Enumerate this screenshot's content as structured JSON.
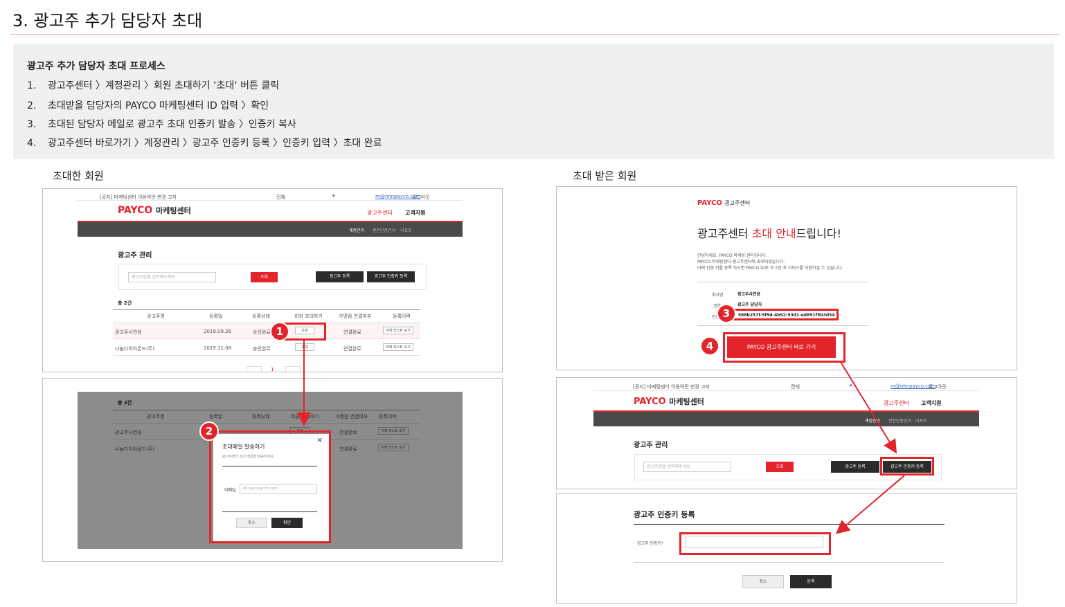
{
  "page_title": "3. 광고주 추가 담당자 초대",
  "process": {
    "heading": "광고주 추가 담당자 초대 프로세스",
    "steps": [
      {
        "num": "1.",
        "text": "광고주센터 〉계정관리 〉회원 초대하기 ‘초대‘ 버튼 클릭"
      },
      {
        "num": "2.",
        "text": "초대받을 담당자의 PAYCO 마케팅센터 ID 입력 〉확인"
      },
      {
        "num": "3.",
        "text": "초대된 담당자 메일로 광고주 초대 인증키 발송 〉인증키 복사"
      },
      {
        "num": "4.",
        "text": "광고주센터 바로가기 〉계정관리 〉광고주 인증키 등록 〉인증키 입력 〉초대 완료"
      }
    ]
  },
  "left": {
    "label": "초대한 회원",
    "notice": "[공지] 마케팅센터 이용약관 변경 고지",
    "notice_select": "전체",
    "user_email": "m@nhnpayco.com",
    "logout": "로그아웃",
    "logo_brand": "PAYCO",
    "logo_suffix": "마케팅센터",
    "nav_advertiser_center": "광고주센터",
    "nav_support": "고객지원",
    "subnav": [
      "계정관리",
      "권한인증관리",
      "리포트"
    ],
    "section_title": "광고주 관리",
    "search_placeholder": "광고주명을 입력해주세요",
    "search_btn": "조회",
    "register_btn": "광고주 등록",
    "authkey_btn": "광고주 인증키 등록",
    "total": "총 2건",
    "columns": [
      "광고주명",
      "등록일",
      "등록상태",
      "회원 초대하기",
      "가맹점 연결여부",
      "등록이력"
    ],
    "rows": [
      {
        "name": "광고주사연용",
        "date": "2019.09.26",
        "status": "승인완료",
        "invite": "초대",
        "link": "연결완료",
        "history": "이력 리스트 보기"
      },
      {
        "name": "나눔다이아몬드(주)",
        "date": "2019.11.08",
        "status": "승인완료",
        "invite": "초대",
        "link": "연결완료",
        "history": "이력 리스트 보기"
      }
    ],
    "pagination": "1",
    "modal": {
      "title": "초대메일 발송하기",
      "desc": "광고주센터 초대 메일을 발송하세요.",
      "email_label": "이메일",
      "email_placeholder": "예) payco@nhn.com",
      "cancel": "취소",
      "confirm": "확인",
      "close": "×"
    }
  },
  "right": {
    "label": "초대 받은 회원",
    "mail_logo_brand": "PAYCO",
    "mail_logo_suffix": "광고주센터",
    "mail_heading_pre": "광고주센터 ",
    "mail_heading_red": "초대 안내",
    "mail_heading_post": "드립니다!",
    "mail_body": [
      "안녕하세요. PAYCO 마케팅 센터입니다.",
      "PAYCO 마케팅센터-광고주센터에 초대되셨습니다.",
      "아래 인증 키를 등록 하시면 PAYCO ID로 로그인 후 서비스를 이용하실 수 있습니다."
    ],
    "info": [
      {
        "label": "회사명",
        "value": "광고주사연용"
      },
      {
        "label": "권한",
        "value": "광고주 담당자"
      },
      {
        "label": "인증키",
        "value": "588b257f-5f9d-4b92-93d1-ed891f5b3d34"
      }
    ],
    "go_button": "PAYCO 광고주센터 바로 가기",
    "section_title": "광고주 관리",
    "auth_title": "광고주 인증키 등록",
    "auth_label": "광고주 인증키",
    "auth_cancel": "취소",
    "auth_submit": "등록"
  },
  "badges": [
    "1",
    "2",
    "3",
    "4"
  ],
  "colors": {
    "accent": "#e4242b",
    "dark_nav": "#4a4a4a",
    "process_bg": "#f0f0f0"
  }
}
